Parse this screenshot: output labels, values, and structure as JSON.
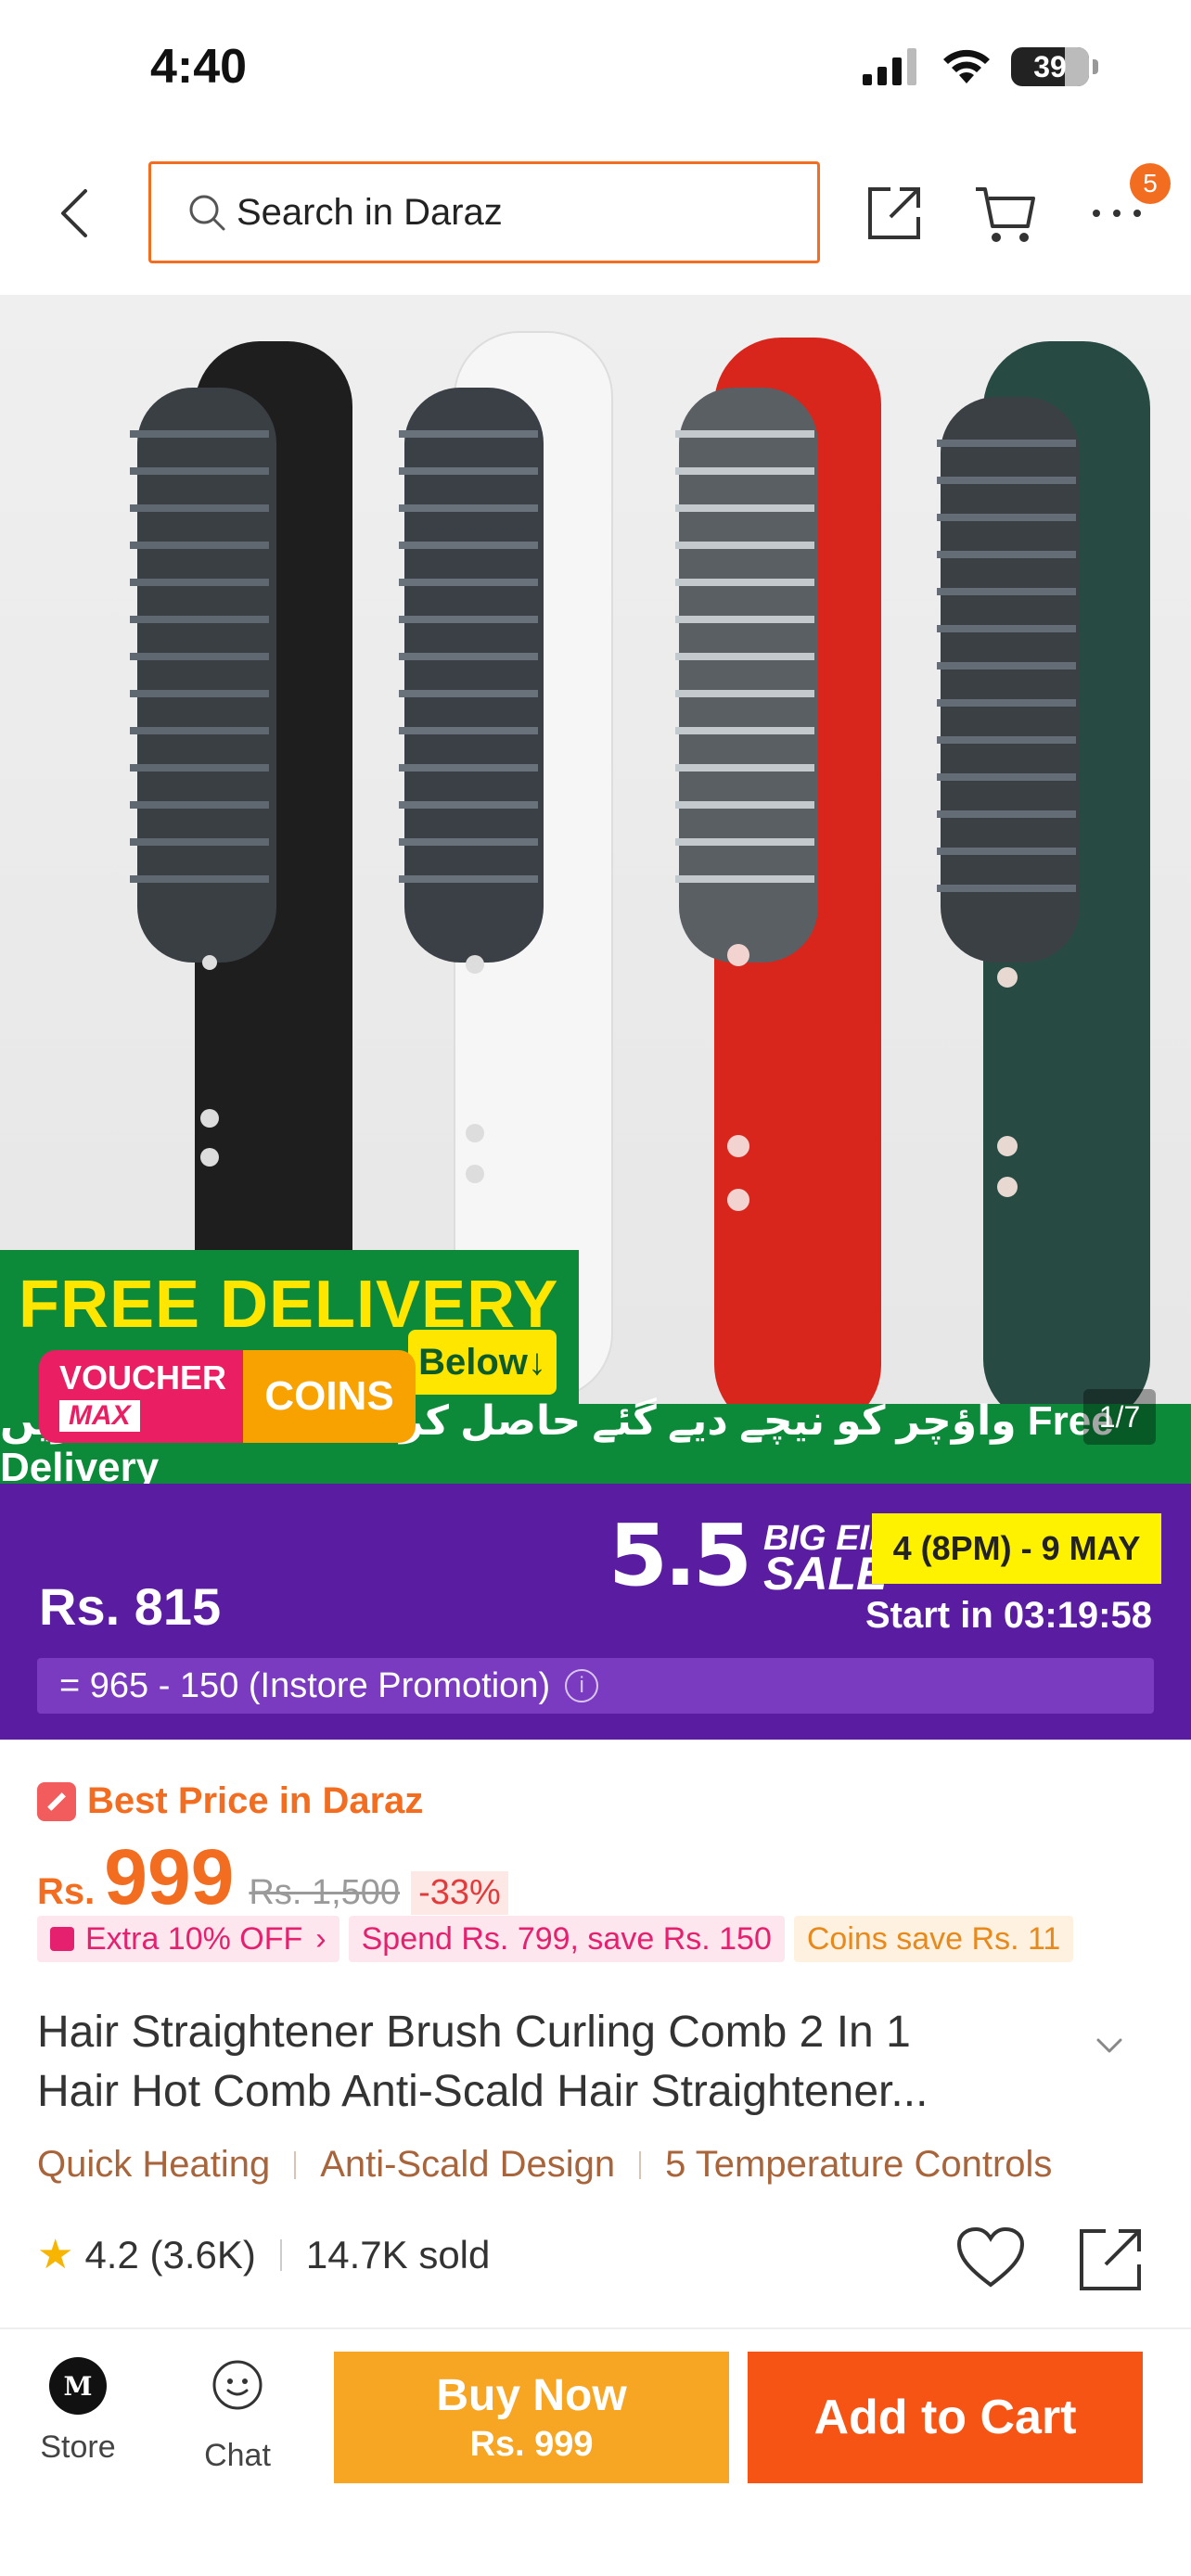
{
  "status_bar": {
    "time": "4:40",
    "battery": "39"
  },
  "header": {
    "search_placeholder": "Search in Daraz",
    "cart_badge": "5"
  },
  "hero": {
    "delivery_title": "FREE DELIVERY",
    "below_text": "Below↓",
    "voucher_line1": "VOUCHER",
    "voucher_line2": "MAX",
    "coins": "COINS",
    "urdu_text": "ریں Collect واؤچر کو نیچے دیے گئے حاصل کرنے کے لیے Free Delivery",
    "page_counter": "1/7",
    "brush_colors": [
      "#1e1e1e",
      "#f4f4f4",
      "#d9261c",
      "#274a43"
    ]
  },
  "promo": {
    "price": "Rs. 815",
    "sale_number": "5.5",
    "sale_word1": "BIG EID",
    "sale_word2": "SALE",
    "date_range": "4 (8PM) - 9 MAY",
    "countdown": "Start in 03:19:58",
    "instore": "= 965 - 150 (Instore Promotion)"
  },
  "details": {
    "best_price": "Best Price in Daraz",
    "currency": "Rs.",
    "price": "999",
    "old_price": "Rs. 1,500",
    "discount": "-33%",
    "chips": [
      "Extra 10% OFF",
      "Spend Rs. 799, save Rs. 150",
      "Coins save Rs. 11"
    ],
    "title_line1": "Hair Straightener Brush Curling Comb 2 In 1",
    "title_line2": "Hair Hot Comb Anti-Scald Hair Straightener...",
    "features": [
      "Quick Heating",
      "Anti-Scald Design",
      "5 Temperature Controls"
    ],
    "rating": "4.2 (3.6K)",
    "sold": "14.7K sold"
  },
  "bottom_bar": {
    "store_label": "Store",
    "chat_label": "Chat",
    "buy_now": "Buy Now",
    "buy_now_price": "Rs. 999",
    "add_to_cart": "Add to Cart"
  }
}
